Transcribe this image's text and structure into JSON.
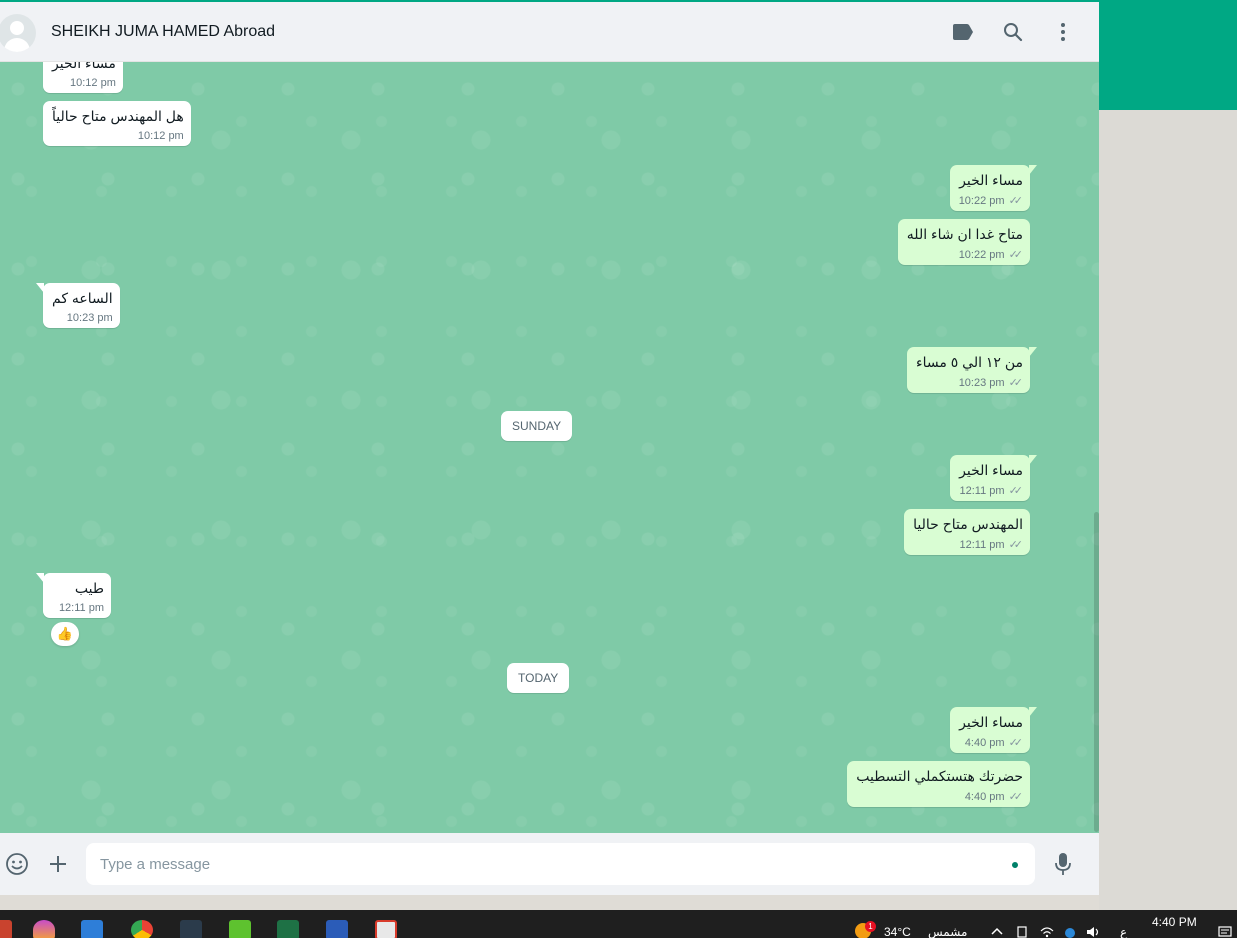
{
  "header": {
    "contact_name": "SHEIKH JUMA HAMED Abroad",
    "icons": [
      "label-icon",
      "search-icon",
      "menu-icon"
    ]
  },
  "messages": [
    {
      "dir": "in",
      "text": "مساء الخير",
      "time": "10:12 pm"
    },
    {
      "dir": "in",
      "text": "هل المهندس متاح حالياً",
      "time": "10:12 pm"
    },
    {
      "dir": "out",
      "text": "مساء الخير",
      "time": "10:22 pm"
    },
    {
      "dir": "out",
      "text": "متاح غدا ان شاء الله",
      "time": "10:22 pm"
    },
    {
      "dir": "in",
      "text": "الساعه كم",
      "time": "10:23 pm"
    },
    {
      "dir": "out",
      "text": "من  ١٢ الي ٥ مساء",
      "time": "10:23 pm"
    },
    {
      "dir": "out",
      "text": "مساء الخير",
      "time": "12:11 pm"
    },
    {
      "dir": "out",
      "text": "المهندس متاح حاليا",
      "time": "12:11 pm"
    },
    {
      "dir": "in",
      "text": "طيب",
      "time": "12:11 pm",
      "reaction": "👍"
    },
    {
      "dir": "out",
      "text": "مساء الخير",
      "time": "4:40 pm"
    },
    {
      "dir": "out",
      "text": "حضرتك هتستكملي التسطيب",
      "time": "4:40 pm"
    }
  ],
  "date_chips": {
    "sunday": "SUNDAY",
    "today": "TODAY"
  },
  "read_receipt": "✓✓",
  "composer": {
    "placeholder": "Type a message",
    "icons": [
      "emoji-icon",
      "attach-icon",
      "mic-icon"
    ]
  },
  "taskbar": {
    "weather_temp": "34°C",
    "weather_text": "مشمس",
    "weather_badge": "1",
    "clock": "4:40 PM",
    "lang": "ع"
  },
  "colors": {
    "accent": "#00a884",
    "chat_bg": "#7fcaa7",
    "outgoing": "#d9fdd3",
    "incoming": "#ffffff"
  }
}
